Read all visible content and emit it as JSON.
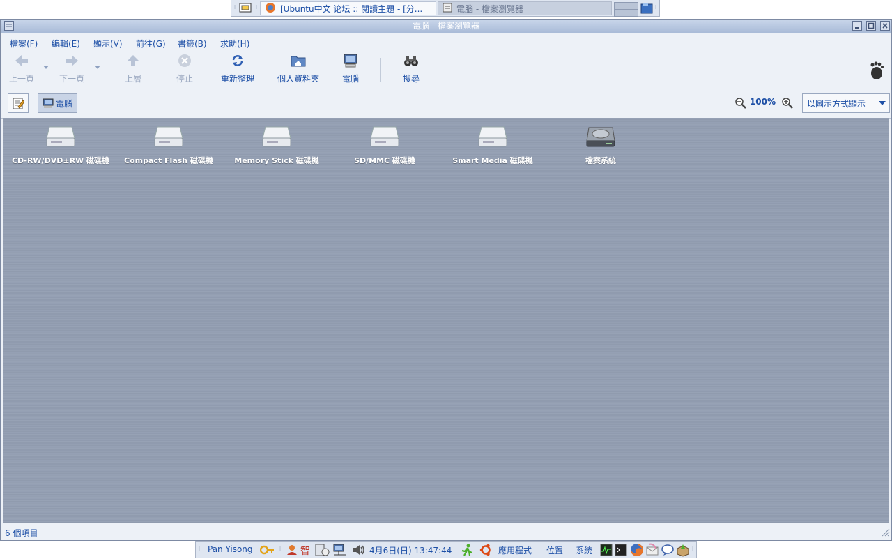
{
  "top_panel": {
    "tasks": [
      {
        "label": "[Ubuntu中文 论坛 :: 閱讀主題 - [分...",
        "icon": "firefox-icon",
        "state": "active"
      },
      {
        "label": "電腦 - 檔案瀏覽器",
        "icon": "file-manager-icon",
        "state": "inactive"
      }
    ]
  },
  "window": {
    "title": "電腦 - 檔案瀏覽器",
    "menu": [
      "檔案(F)",
      "編輯(E)",
      "顯示(V)",
      "前往(G)",
      "書籤(B)",
      "求助(H)"
    ],
    "toolbar": {
      "back": "上一頁",
      "forward": "下一頁",
      "up": "上層",
      "stop": "停止",
      "reload": "重新整理",
      "home": "個人資料夾",
      "computer": "電腦",
      "search": "搜尋"
    },
    "location": {
      "button_label": "電腦",
      "zoom": "100%",
      "view_mode": "以圖示方式顯示"
    },
    "items": [
      {
        "label": "CD-RW/DVD±RW 磁碟機",
        "icon": "optical-drive-icon"
      },
      {
        "label": "Compact Flash 磁碟機",
        "icon": "removable-drive-icon"
      },
      {
        "label": "Memory Stick 磁碟機",
        "icon": "removable-drive-icon"
      },
      {
        "label": "SD/MMC 磁碟機",
        "icon": "removable-drive-icon"
      },
      {
        "label": "Smart Media 磁碟機",
        "icon": "removable-drive-icon"
      },
      {
        "label": "檔案系統",
        "icon": "harddisk-icon"
      }
    ],
    "status": "6 個項目"
  },
  "bottom_panel": {
    "user": "Pan Yisong",
    "clock": "4月6日(日) 13:47:44",
    "menus": [
      "應用程式",
      "位置",
      "系統"
    ]
  },
  "colors": {
    "accent": "#1d4fa6",
    "content_bg": "#959fb3",
    "panel_bg": "#dfe6f1"
  }
}
